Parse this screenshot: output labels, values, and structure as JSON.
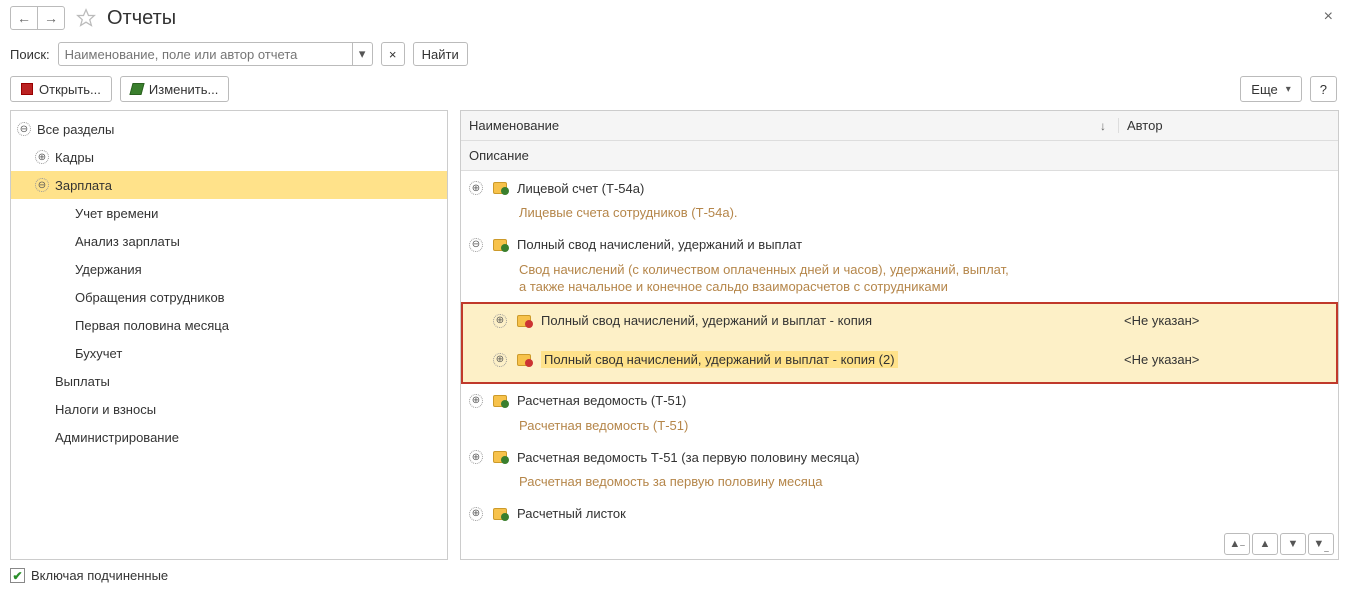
{
  "header": {
    "title": "Отчеты"
  },
  "search": {
    "label": "Поиск:",
    "placeholder": "Наименование, поле или автор отчета",
    "clear": "×",
    "find_btn": "Найти"
  },
  "toolbar": {
    "open": "Открыть...",
    "edit": "Изменить...",
    "more": "Еще",
    "help": "?"
  },
  "tree": {
    "root": "Все разделы",
    "kadry": "Кадры",
    "zarplata": "Зарплата",
    "zarplata_children": {
      "uchet": "Учет времени",
      "analiz": "Анализ зарплаты",
      "uderzh": "Удержания",
      "obrash": "Обращения сотрудников",
      "perv": "Первая половина месяца",
      "buh": "Бухучет"
    },
    "vyplaty": "Выплаты",
    "nalogi": "Налоги и взносы",
    "admin": "Администрирование"
  },
  "columns": {
    "name": "Наименование",
    "author": "Автор",
    "description": "Описание"
  },
  "list": {
    "i0": {
      "name": "Лицевой счет (Т-54а)",
      "desc": "Лицевые счета сотрудников (Т-54а)."
    },
    "i1": {
      "name": "Полный свод начислений, удержаний и выплат",
      "desc": "Свод начислений (с количеством оплаченных дней и часов), удержаний, выплат,\nа также начальное и конечное сальдо взаиморасчетов с сотрудниками"
    },
    "i1a": {
      "name": "Полный свод начислений, удержаний и выплат - копия",
      "author": "<Не указан>"
    },
    "i1b": {
      "name": "Полный свод начислений, удержаний и выплат - копия (2)",
      "author": "<Не указан>"
    },
    "i2": {
      "name": "Расчетная ведомость (Т-51)",
      "desc": "Расчетная ведомость (Т-51)"
    },
    "i3": {
      "name": "Расчетная ведомость Т-51 (за первую половину месяца)",
      "desc": "Расчетная ведомость за первую половину месяца"
    },
    "i4": {
      "name": "Расчетный листок"
    }
  },
  "footer": {
    "include_sub": "Включая подчиненные"
  }
}
